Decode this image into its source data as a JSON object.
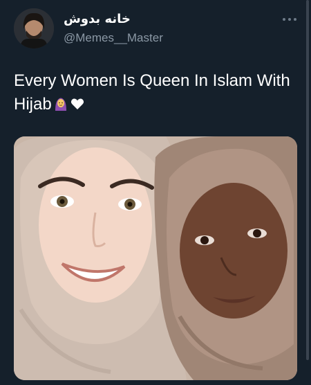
{
  "author": {
    "display_name": "خانه بدوش",
    "handle": "@Memes__Master",
    "avatar_icon": "profile-avatar"
  },
  "more_menu_icon": "more-options-icon",
  "tweet": {
    "text": "Every Women Is Queen In Islam With Hijab",
    "emojis": [
      "woman-with-headscarf-emoji",
      "white-heart-emoji"
    ]
  },
  "media": {
    "alt": "photo of two smiling women wearing hijabs"
  },
  "colors": {
    "background": "#15202b",
    "text_primary": "#ffffff",
    "text_secondary": "#8b98a5"
  }
}
